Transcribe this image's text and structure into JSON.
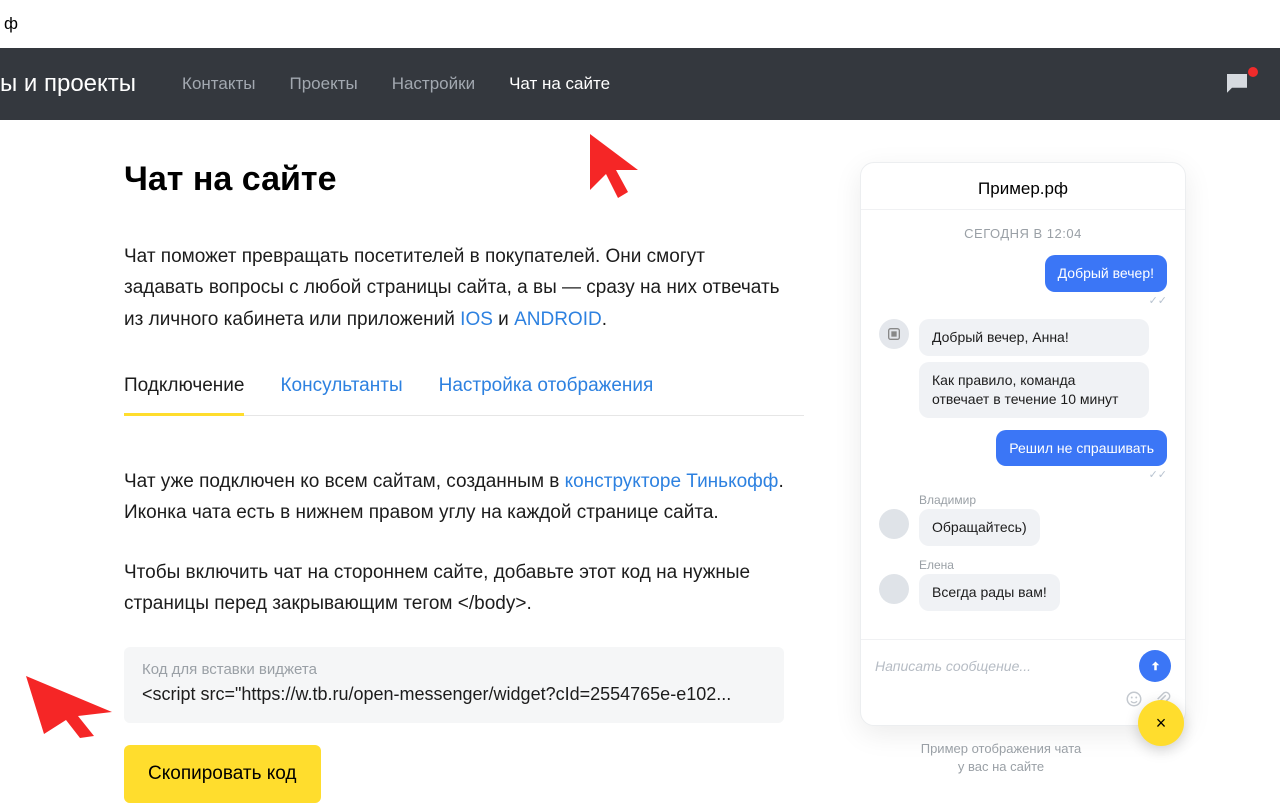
{
  "topbar": {
    "suffix": "ф"
  },
  "nav": {
    "title": "ы и проекты",
    "items": [
      "Контакты",
      "Проекты",
      "Настройки",
      "Чат на сайте"
    ],
    "active_index": 3
  },
  "page": {
    "title": "Чат на сайте",
    "lead_pre": "Чат поможет превращать посетителей в покупателей. Они смогут задавать вопросы с любой страницы сайта, а вы — сразу на них отвечать из личного кабинета или приложений ",
    "ios": "IOS",
    "and": " и ",
    "android": "ANDROID",
    "period": "."
  },
  "tabs": {
    "items": [
      "Подключение",
      "Консультанты",
      "Настройка отображения"
    ],
    "active_index": 0
  },
  "desc1_pre": "Чат уже подключен ко всем сайтам, созданным в ",
  "desc1_link": "конструкторе Тинькофф",
  "desc1_post": ". Иконка чата есть в нижнем правом углу на каждой странице сайта.",
  "desc2": "Чтобы включить чат на стороннем сайте, добавьте этот код на нужные страницы перед закрывающим тегом </body>.",
  "codebox": {
    "label": "Код для вставки виджета",
    "content": "<script src=\"https://w.tb.ru/open-messenger/widget?cId=2554765e-e102..."
  },
  "copy_button": "Скопировать код",
  "preview": {
    "header": "Пример.рф",
    "date": "СЕГОДНЯ В 12:04",
    "msgs": {
      "m1": "Добрый вечер!",
      "m2": "Добрый вечер, Анна!",
      "m3": "Как правило, команда отвечает в течение 10 минут",
      "m4": "Решил не спрашивать",
      "name1": "Владимир",
      "m5": "Обращайтесь)",
      "name2": "Елена",
      "m6": "Всегда рады вам!"
    },
    "input_placeholder": "Написать сообщение...",
    "caption_l1": "Пример отображения чата",
    "caption_l2": "у вас на сайте"
  },
  "fab": {
    "label": "×"
  }
}
